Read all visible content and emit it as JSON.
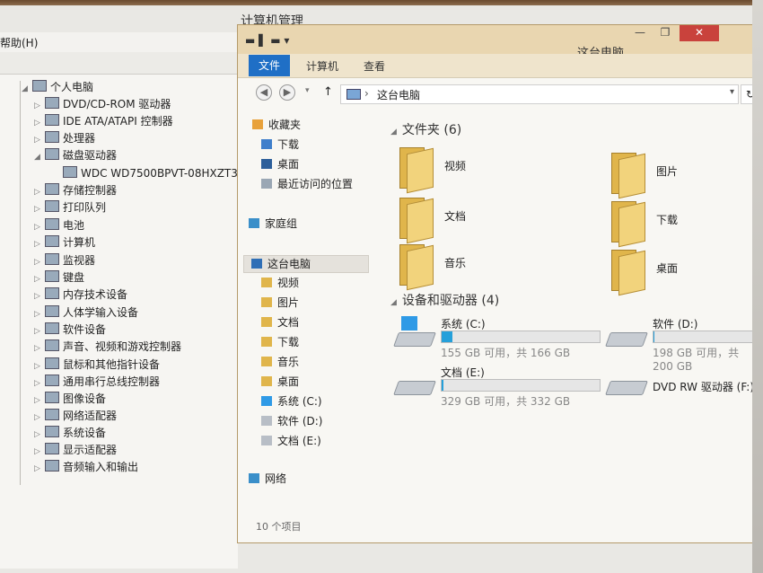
{
  "back_window": {
    "title": "计算机管理",
    "menu_help": "帮助(H)",
    "tree": [
      {
        "label": "个人电脑",
        "arrow": "◢"
      },
      {
        "label": "DVD/CD-ROM 驱动器",
        "arrow": "▷"
      },
      {
        "label": "IDE ATA/ATAPI 控制器",
        "arrow": "▷"
      },
      {
        "label": "处理器",
        "arrow": "▷"
      },
      {
        "label": "磁盘驱动器",
        "arrow": "◢"
      },
      {
        "label": "WDC WD7500BPVT-08HXZT3",
        "arrow": ""
      },
      {
        "label": "存储控制器",
        "arrow": "▷"
      },
      {
        "label": "打印队列",
        "arrow": "▷"
      },
      {
        "label": "电池",
        "arrow": "▷"
      },
      {
        "label": "计算机",
        "arrow": "▷"
      },
      {
        "label": "监视器",
        "arrow": "▷"
      },
      {
        "label": "键盘",
        "arrow": "▷"
      },
      {
        "label": "内存技术设备",
        "arrow": "▷"
      },
      {
        "label": "人体学输入设备",
        "arrow": "▷"
      },
      {
        "label": "软件设备",
        "arrow": "▷"
      },
      {
        "label": "声音、视频和游戏控制器",
        "arrow": "▷"
      },
      {
        "label": "鼠标和其他指针设备",
        "arrow": "▷"
      },
      {
        "label": "通用串行总线控制器",
        "arrow": "▷"
      },
      {
        "label": "图像设备",
        "arrow": "▷"
      },
      {
        "label": "网络适配器",
        "arrow": "▷"
      },
      {
        "label": "系统设备",
        "arrow": "▷"
      },
      {
        "label": "显示适配器",
        "arrow": "▷"
      },
      {
        "label": "音频输入和输出",
        "arrow": "▷"
      }
    ]
  },
  "explorer": {
    "title": "这台电脑",
    "quick_access": "▬ ▌ ▬ ▾",
    "window_buttons": {
      "minimize": "—",
      "maximize": "❐",
      "close": "✕"
    },
    "tabs": [
      "文件",
      "计算机",
      "查看"
    ],
    "nav": {
      "back": "◀",
      "forward": "▶",
      "up": "↑",
      "recent": "▾",
      "address": "这台电脑",
      "addr_arrow": "›",
      "dropdown": "▾",
      "refresh": "↻"
    },
    "navpane": [
      {
        "label": "收藏夹",
        "icon": "star-icon",
        "color": "#e8a13a"
      },
      {
        "label": "下载",
        "icon": "download-folder-icon",
        "color": "#3f7fcb"
      },
      {
        "label": "桌面",
        "icon": "desktop-icon",
        "color": "#2d5f9a"
      },
      {
        "label": "最近访问的位置",
        "icon": "recent-places-icon",
        "color": "#9aa7b4"
      },
      {
        "label": "家庭组",
        "icon": "homegroup-icon",
        "color": "#3a8fc9"
      },
      {
        "label": "这台电脑",
        "icon": "computer-icon",
        "color": "#2f6fb6"
      },
      {
        "label": "视频",
        "icon": "video-folder-icon",
        "color": "#e0b54b"
      },
      {
        "label": "图片",
        "icon": "pictures-folder-icon",
        "color": "#e0b54b"
      },
      {
        "label": "文档",
        "icon": "documents-folder-icon",
        "color": "#e0b54b"
      },
      {
        "label": "下载",
        "icon": "download-folder-icon",
        "color": "#e0b54b"
      },
      {
        "label": "音乐",
        "icon": "music-folder-icon",
        "color": "#e0b54b"
      },
      {
        "label": "桌面",
        "icon": "desktop-folder-icon",
        "color": "#e0b54b"
      },
      {
        "label": "系统 (C:)",
        "icon": "system-drive-icon",
        "color": "#2f9ae6"
      },
      {
        "label": "软件 (D:)",
        "icon": "drive-icon",
        "color": "#b8bec6"
      },
      {
        "label": "文档 (E:)",
        "icon": "drive-icon",
        "color": "#b8bec6"
      },
      {
        "label": "网络",
        "icon": "network-icon",
        "color": "#3a8fc9"
      }
    ],
    "folders_header": "文件夹 (6)",
    "folders": [
      {
        "label": "视频",
        "icon": "video-folder-icon"
      },
      {
        "label": "图片",
        "icon": "pictures-folder-icon"
      },
      {
        "label": "文档",
        "icon": "documents-folder-icon"
      },
      {
        "label": "下载",
        "icon": "download-folder-icon"
      },
      {
        "label": "音乐",
        "icon": "music-folder-icon"
      },
      {
        "label": "桌面",
        "icon": "desktop-folder-icon"
      }
    ],
    "devices_header": "设备和驱动器 (4)",
    "drives": [
      {
        "name": "系统 (C:)",
        "free": "155 GB 可用，共 166 GB",
        "used_fraction": 0.07,
        "icon": "system-drive-icon"
      },
      {
        "name": "软件 (D:)",
        "free": "198 GB 可用，共 200 GB",
        "used_fraction": 0.01,
        "icon": "drive-icon"
      },
      {
        "name": "文档 (E:)",
        "free": "329 GB 可用，共 332 GB",
        "used_fraction": 0.01,
        "icon": "drive-icon"
      },
      {
        "name": "DVD RW 驱动器 (F:)",
        "free": "",
        "icon": "dvd-drive-icon"
      }
    ],
    "status": "10 个项目",
    "accent": "#1f6fc6",
    "bar_color": "#26a0da"
  }
}
